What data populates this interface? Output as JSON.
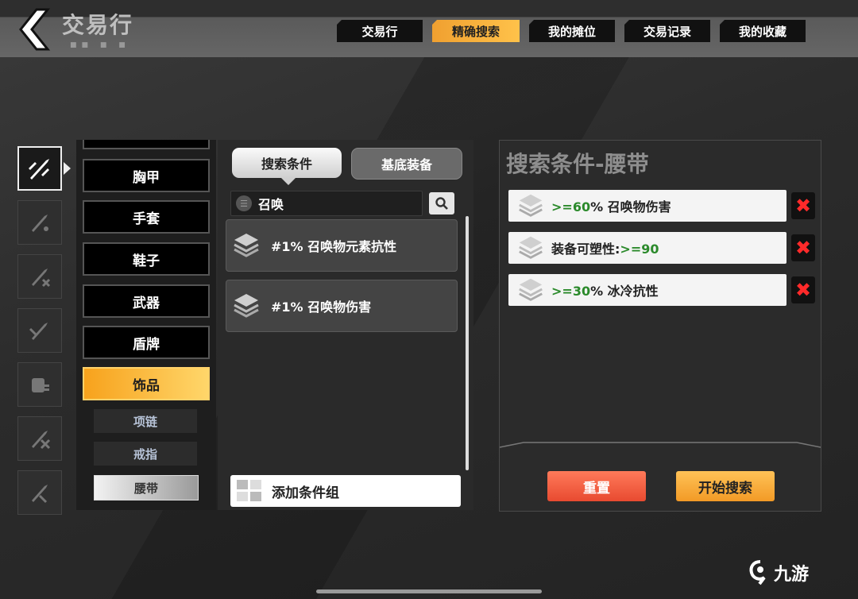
{
  "header": {
    "title": "交易行",
    "tabs": [
      {
        "label": "交易行",
        "active": false
      },
      {
        "label": "精确搜索",
        "active": true
      },
      {
        "label": "我的摊位",
        "active": false
      },
      {
        "label": "交易记录",
        "active": false
      },
      {
        "label": "我的收藏",
        "active": false
      }
    ]
  },
  "categories": {
    "items": [
      {
        "label": "胸甲",
        "active": false
      },
      {
        "label": "手套",
        "active": false
      },
      {
        "label": "鞋子",
        "active": false
      },
      {
        "label": "武器",
        "active": false
      },
      {
        "label": "盾牌",
        "active": false
      },
      {
        "label": "饰品",
        "active": true
      }
    ],
    "subitems": [
      {
        "label": "项链",
        "active": false
      },
      {
        "label": "戒指",
        "active": false
      },
      {
        "label": "腰带",
        "active": true
      }
    ]
  },
  "middle": {
    "seg_on": "搜索条件",
    "seg_off": "基底装备",
    "search_value": "召唤",
    "results": [
      "#1% 召唤物元素抗性",
      "#1% 召唤物伤害"
    ],
    "add_group": "添加条件组"
  },
  "right": {
    "title": "搜索条件-腰带",
    "conditions": [
      {
        "pre": ">=60",
        "mid": "% 召唤物伤害",
        "post": ""
      },
      {
        "pre": "",
        "mid": "装备可塑性:",
        "post": ">=90"
      },
      {
        "pre": ">=30",
        "mid": "% 冰冷抗性",
        "post": ""
      }
    ],
    "reset": "重置",
    "start": "开始搜索"
  },
  "watermark": "九游",
  "colors": {
    "accent": "#f7a21c",
    "delete": "#ff2a2a",
    "green_text": "#2b8a2b"
  }
}
